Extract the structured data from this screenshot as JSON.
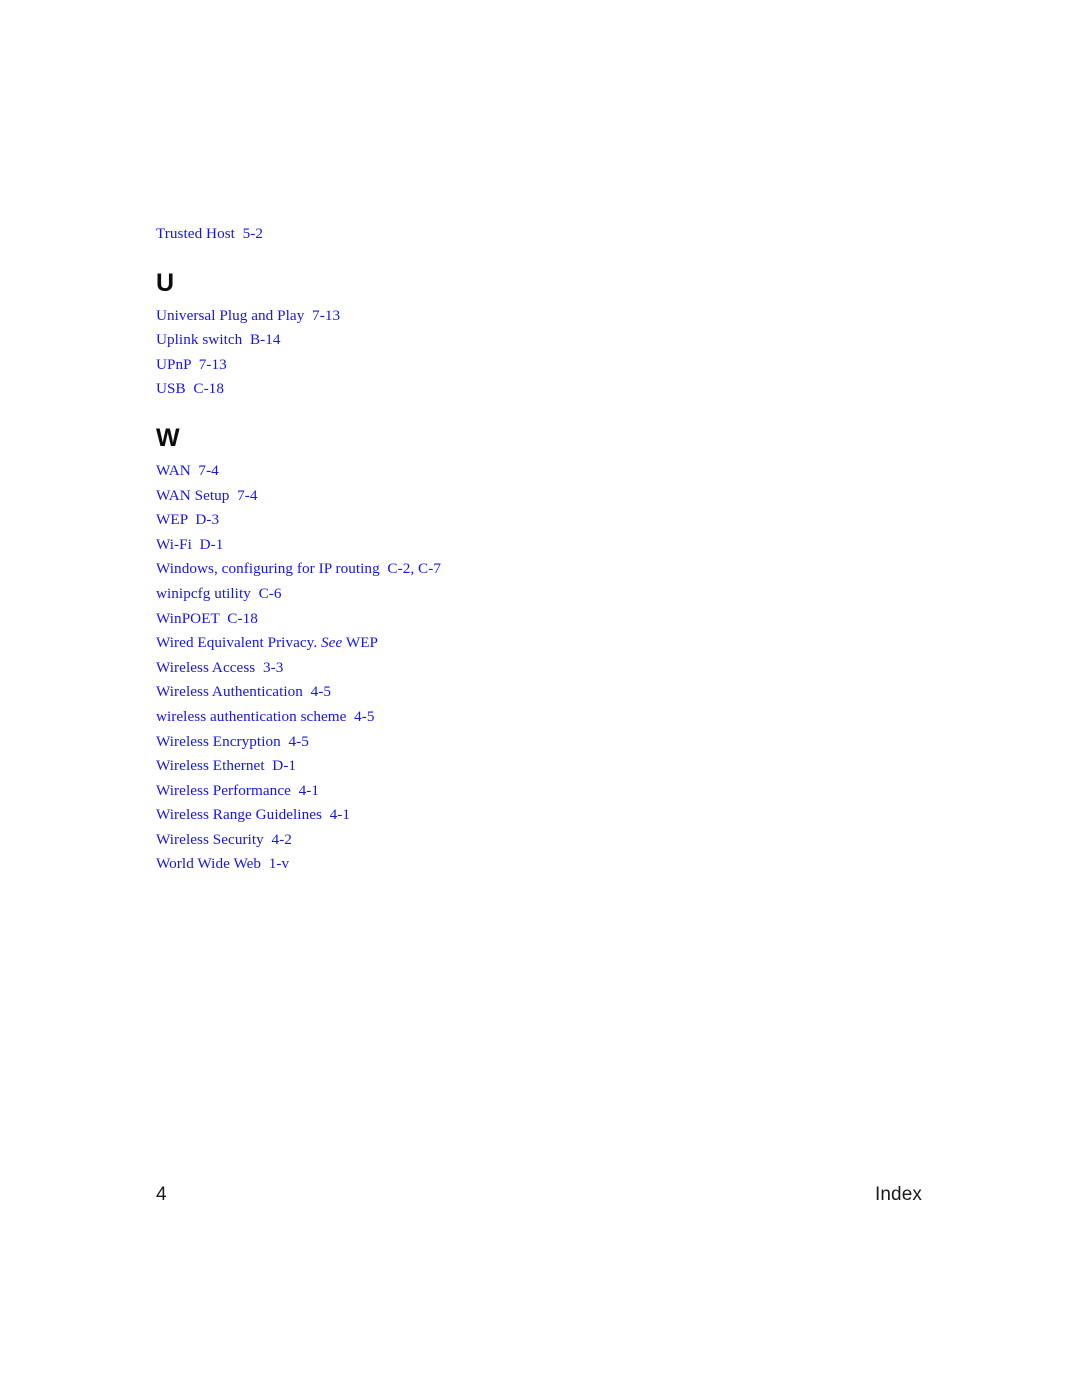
{
  "document": {
    "type": "index-page",
    "page_number": "4",
    "footer_label": "Index",
    "link_color": "#1414f0",
    "heading_color": "#0d0d0d",
    "background_color": "#ffffff"
  },
  "index": {
    "leading_entries": [
      {
        "text": "Trusted Host  5-2"
      }
    ],
    "sections": [
      {
        "letter": "U",
        "entries": [
          {
            "text": "Universal Plug and Play  7-13"
          },
          {
            "text": "Uplink switch  B-14"
          },
          {
            "text": "UPnP  7-13"
          },
          {
            "text": "USB  C-18"
          }
        ]
      },
      {
        "letter": "W",
        "entries": [
          {
            "text": "WAN  7-4"
          },
          {
            "text": "WAN Setup  7-4"
          },
          {
            "text": "WEP  D-3"
          },
          {
            "text": "Wi-Fi  D-1"
          },
          {
            "text": "Windows, configuring for IP routing  C-2, C-7"
          },
          {
            "text": "winipcfg utility  C-6"
          },
          {
            "text": "WinPOET  C-18"
          },
          {
            "text": "Wired Equivalent Privacy. ",
            "italic": "See",
            "text_after": " WEP"
          },
          {
            "text": "Wireless Access  3-3"
          },
          {
            "text": "Wireless Authentication  4-5"
          },
          {
            "text": "wireless authentication scheme  4-5"
          },
          {
            "text": "Wireless Encryption  4-5"
          },
          {
            "text": "Wireless Ethernet  D-1"
          },
          {
            "text": "Wireless Performance  4-1"
          },
          {
            "text": "Wireless Range Guidelines  4-1"
          },
          {
            "text": "Wireless Security  4-2"
          },
          {
            "text": "World Wide Web  1-v"
          }
        ]
      }
    ]
  }
}
